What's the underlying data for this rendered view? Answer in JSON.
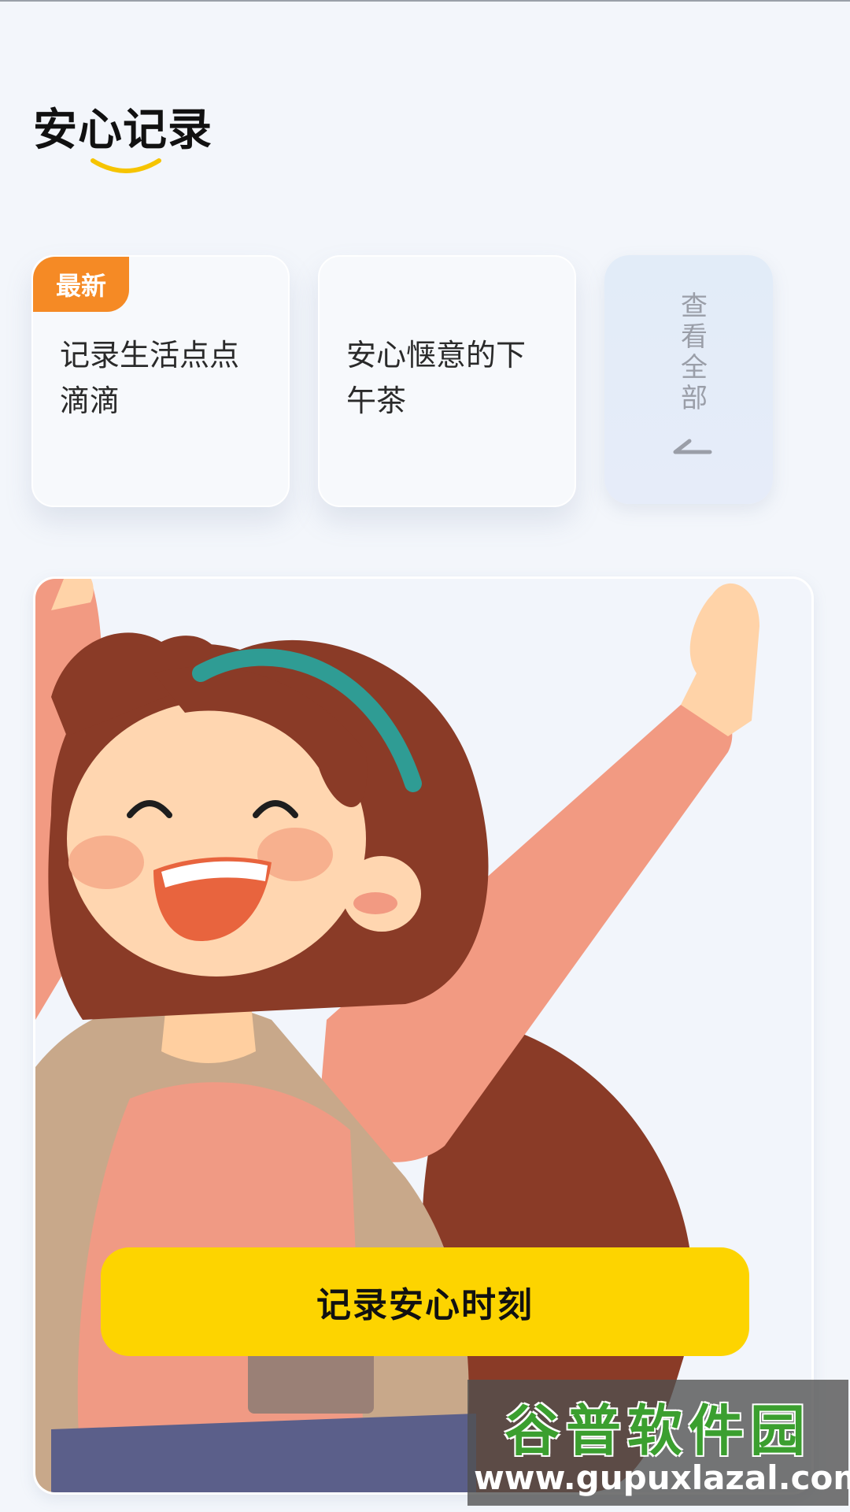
{
  "header": {
    "title": "安心记录"
  },
  "cards": [
    {
      "badge": "最新",
      "text": "记录生活点点滴滴"
    },
    {
      "text": "安心惬意的下午茶"
    }
  ],
  "view_all": {
    "label": "查看全部"
  },
  "hero": {
    "illustration": "cheerful-girl-illustration"
  },
  "cta": {
    "label": "记录安心时刻"
  },
  "watermark": {
    "logo": "谷普软件园",
    "url": "www.gupuxlazal.com"
  },
  "colors": {
    "accent_yellow": "#fdd400",
    "badge_orange": "#f58a25",
    "background": "#f3f6fb"
  }
}
